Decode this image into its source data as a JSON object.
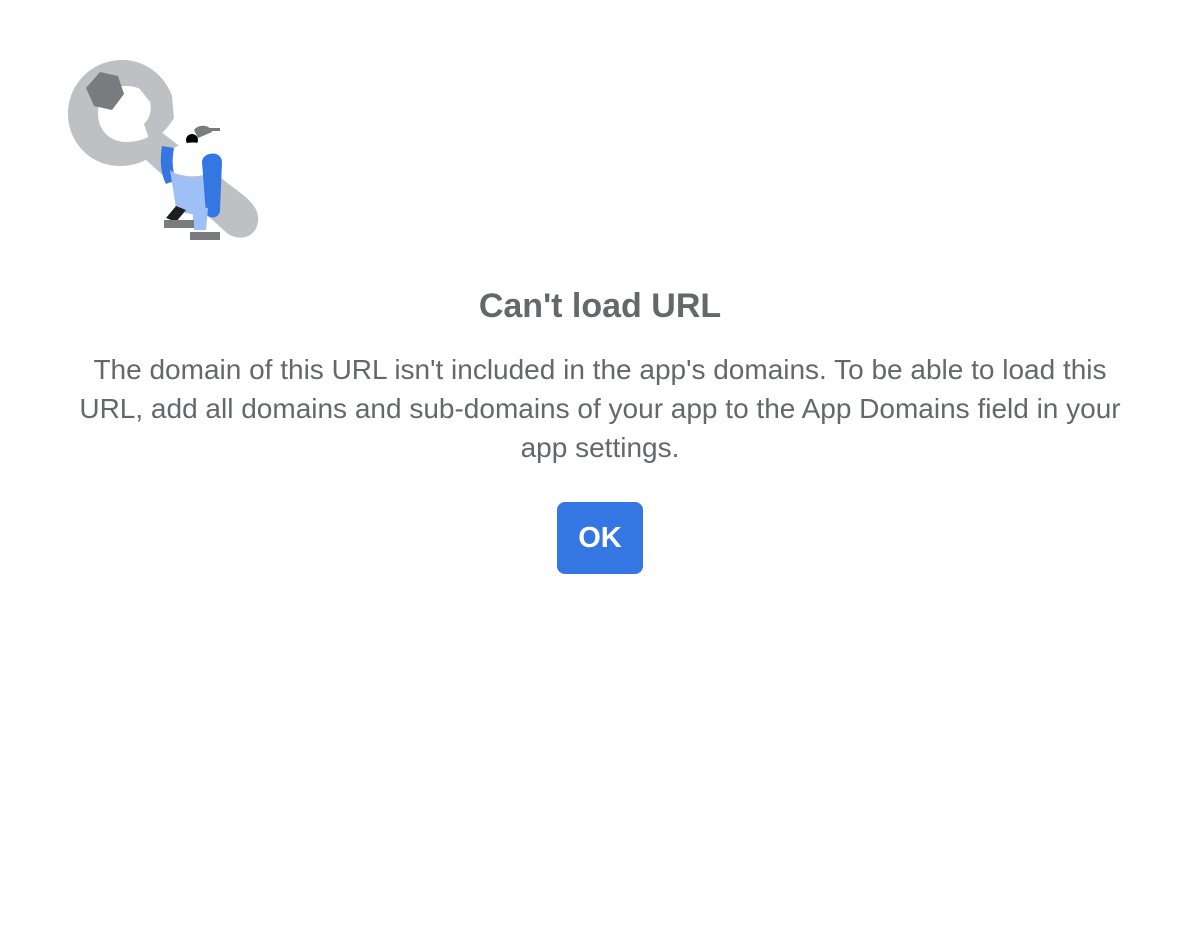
{
  "illustration": {
    "icon": "wrench-worker-illustration"
  },
  "error": {
    "title": "Can't load URL",
    "message": "The domain of this URL isn't included in the app's domains. To be able to load this URL, add all domains and sub-domains of your app to the App Domains field in your app settings."
  },
  "actions": {
    "ok_label": "OK"
  },
  "colors": {
    "text": "#65676b",
    "button": "#3476e2",
    "button_text": "#ffffff",
    "wrench": "#bec0c3",
    "hex_nut": "#7a7b7e",
    "worker_blue": "#3476e2",
    "worker_light_blue": "#9ec0f7"
  }
}
